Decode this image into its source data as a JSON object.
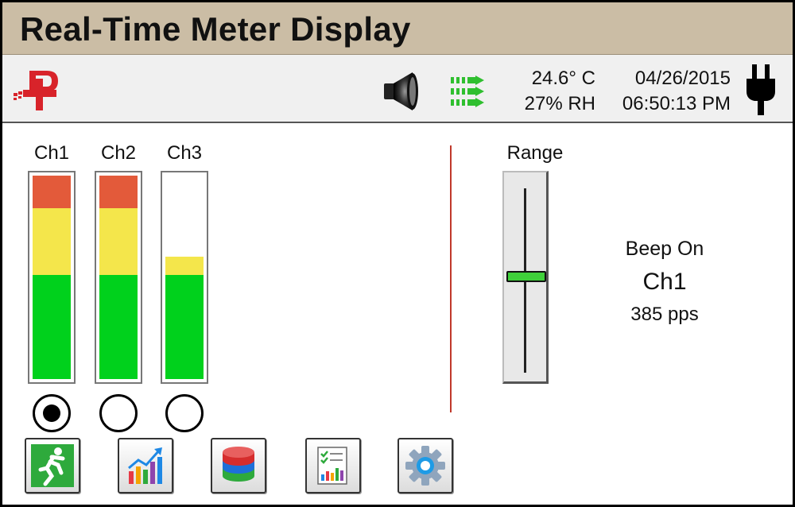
{
  "header": {
    "title": "Real-Time Meter Display"
  },
  "status": {
    "temperature": "24.6° C",
    "humidity": "27% RH",
    "date": "04/26/2015",
    "time": "06:50:13 PM",
    "icons": [
      "logo-icon",
      "speaker-icon",
      "signal-arrows-icon",
      "power-plug-icon"
    ]
  },
  "channels": [
    {
      "label": "Ch1",
      "red": 0.16,
      "yellow": 0.33,
      "green": 0.51,
      "selected": true
    },
    {
      "label": "Ch2",
      "red": 0.16,
      "yellow": 0.33,
      "green": 0.51,
      "selected": false
    },
    {
      "label": "Ch3",
      "red": 0.0,
      "yellow": 0.09,
      "green": 0.51,
      "selected": false
    }
  ],
  "range": {
    "label": "Range",
    "level": 0.52
  },
  "beep": {
    "status": "Beep On",
    "channel": "Ch1",
    "rate": "385 pps"
  },
  "toolbar": {
    "buttons": [
      "run-icon",
      "chart-icon",
      "database-icon",
      "report-icon",
      "settings-gear-icon"
    ]
  },
  "colors": {
    "title_bg": "#cbbda5",
    "red": "#e35a3a",
    "yellow": "#f4e64b",
    "green": "#00d11c",
    "divider": "#c0392b"
  }
}
